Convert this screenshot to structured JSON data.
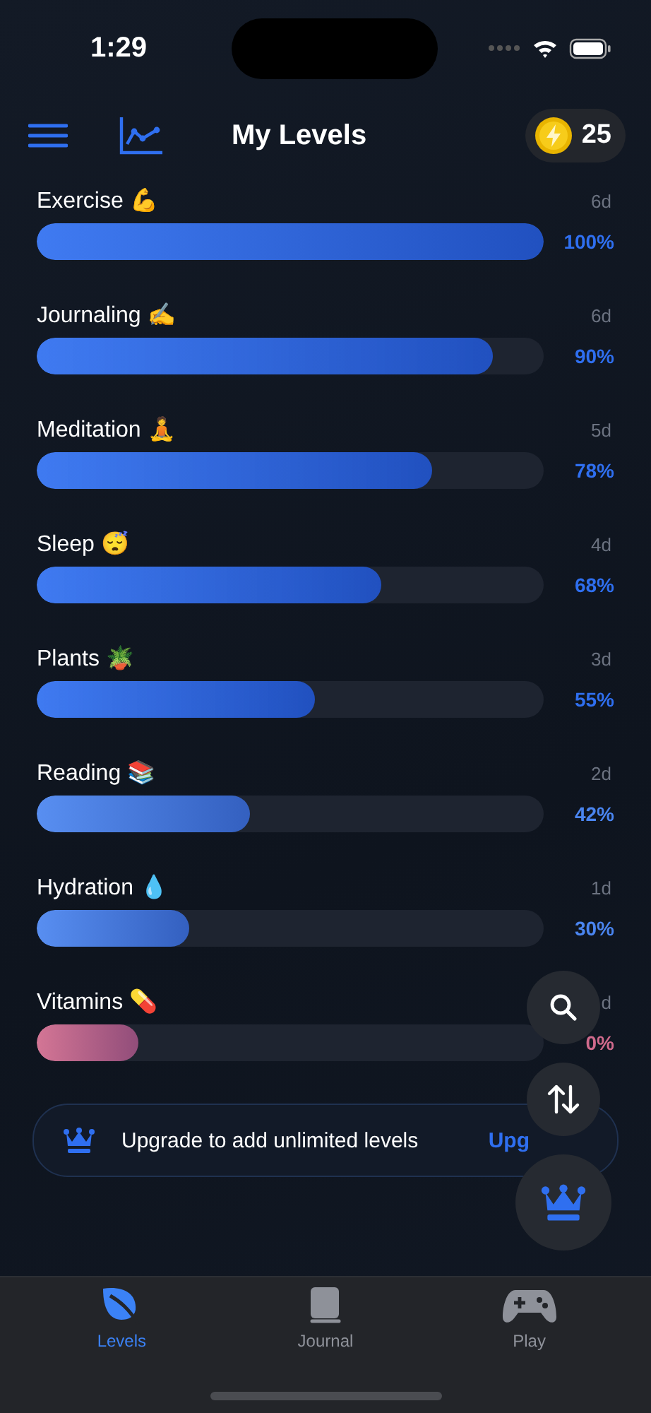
{
  "status_bar": {
    "time": "1:29"
  },
  "header": {
    "title": "My Levels",
    "coins": "25"
  },
  "levels": [
    {
      "name": "Exercise 💪",
      "days": "6d",
      "level": 1.0,
      "reading": "100%",
      "color": "#2f6ff0"
    },
    {
      "name": "Journaling ✍️",
      "days": "6d",
      "level": 0.9,
      "reading": "90%",
      "color": "#2f6ff0"
    },
    {
      "name": "Meditation 🧘",
      "days": "5d",
      "level": 0.78,
      "reading": "78%",
      "color": "#2f6ff0"
    },
    {
      "name": "Sleep 😴",
      "days": "4d",
      "level": 0.68,
      "reading": "68%",
      "color": "#2f6ff0"
    },
    {
      "name": "Plants 🪴",
      "days": "3d",
      "level": 0.55,
      "reading": "55%",
      "color": "#2f6ff0"
    },
    {
      "name": "Reading 📚",
      "days": "2d",
      "level": 0.42,
      "reading": "42%",
      "color": "#4a85f0"
    },
    {
      "name": "Hydration 💧",
      "days": "1d",
      "level": 0.3,
      "reading": "30%",
      "color": "#4a85f0"
    },
    {
      "name": "Vitamins 💊",
      "days": "d",
      "level": 0.2,
      "reading": "0%",
      "color": "#d06a8c"
    }
  ],
  "banner": {
    "text": "Upgrade to add unlimited levels",
    "action": "Upg"
  },
  "tabs": [
    {
      "label": "Levels",
      "selected": true,
      "kind": "leaf"
    },
    {
      "label": "Journal",
      "selected": false,
      "kind": "book"
    },
    {
      "label": "Play",
      "selected": false,
      "kind": "gamepad"
    }
  ]
}
